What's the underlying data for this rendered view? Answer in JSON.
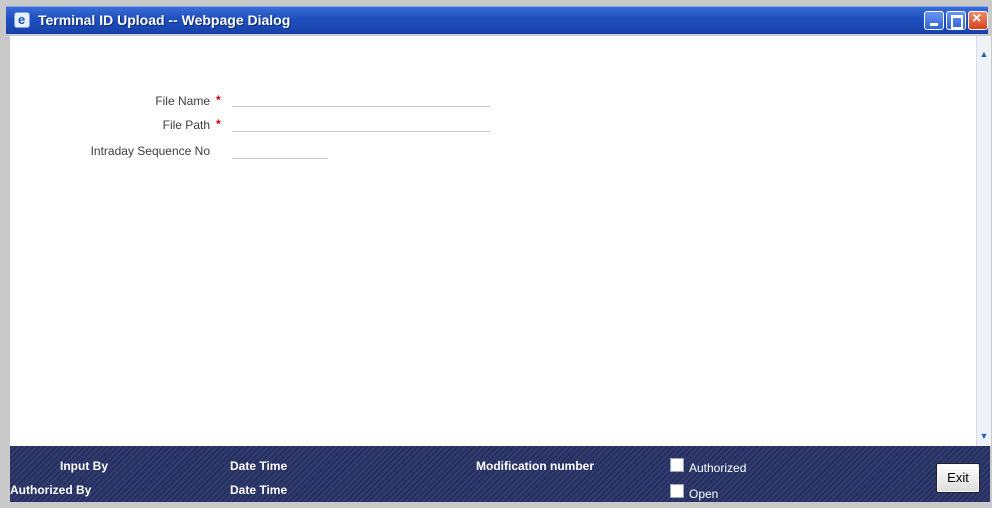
{
  "window": {
    "title": "Terminal ID Upload -- Webpage Dialog",
    "icon": "ie-icon",
    "controls": [
      "minimize-icon",
      "maximize-icon",
      "close-icon"
    ]
  },
  "form": {
    "file_name_label": "File Name",
    "file_path_label": "File Path",
    "intraday_label": "Intraday Sequence No",
    "required_mark": "*",
    "file_name_value": "",
    "file_path_value": "",
    "intraday_value": ""
  },
  "footer": {
    "input_by": "Input By",
    "authorized_by": "Authorized By",
    "date_time_1": "Date Time",
    "date_time_2": "Date Time",
    "modification_number": "Modification number",
    "authorized": "Authorized",
    "open": "Open",
    "exit": "Exit"
  },
  "colors": {
    "title_bar": "#1f4fbf",
    "footer_bg": "#2b3566",
    "required": "#d40000"
  }
}
